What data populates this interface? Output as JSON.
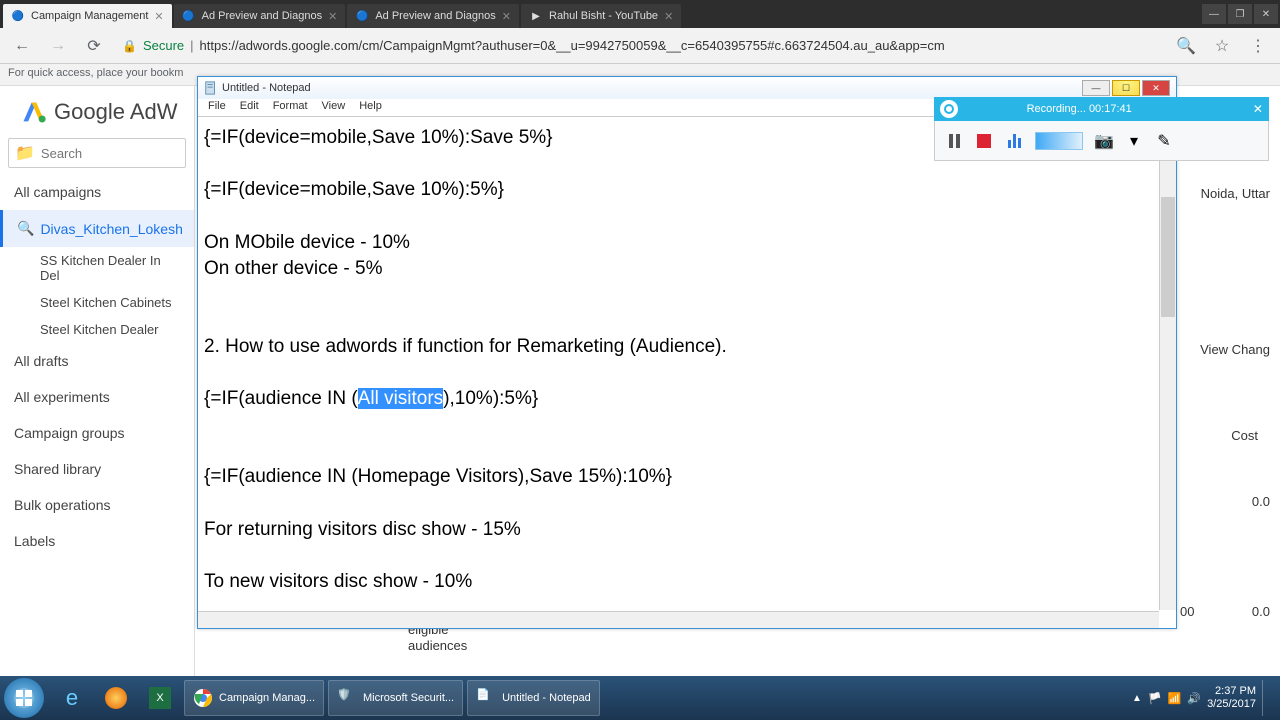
{
  "browser": {
    "tabs": [
      {
        "title": "Campaign Management",
        "fav": "g"
      },
      {
        "title": "Ad Preview and Diagnos",
        "fav": "g"
      },
      {
        "title": "Ad Preview and Diagnos",
        "fav": "g"
      },
      {
        "title": "Rahul Bisht - YouTube",
        "fav": "yt"
      }
    ],
    "secure_label": "Secure",
    "url": "https://adwords.google.com/cm/CampaignMgmt?authuser=0&__u=9942750059&__c=6540395755#c.663724504.au_au&app=cm",
    "bookmark_hint": "For quick access, place your bookm"
  },
  "adwords": {
    "logo": "Google AdW",
    "search_placeholder": "Search",
    "nav": {
      "all_campaigns": "All campaigns",
      "divas": "Divas_Kitchen_Lokesh",
      "subs": [
        "SS Kitchen Dealer In Del",
        "Steel Kitchen Cabinets",
        "Steel Kitchen Dealer"
      ],
      "all_drafts": "All drafts",
      "all_experiments": "All experiments",
      "campaign_groups": "Campaign groups",
      "shared_library": "Shared library",
      "bulk_operations": "Bulk operations",
      "labels": "Labels"
    },
    "right": {
      "location": "Noida, Uttar",
      "view_change": "View Chang",
      "cost": "Cost",
      "v1": "0.0",
      "v2": "00",
      "v3": "0.0",
      "eligible": "eligible",
      "audiences": "audiences"
    }
  },
  "notepad": {
    "title": "Untitled - Notepad",
    "menu": [
      "File",
      "Edit",
      "Format",
      "View",
      "Help"
    ],
    "l1": "{=IF(device=mobile,Save 10%):Save 5%}",
    "l2": "{=IF(device=mobile,Save 10%):5%}",
    "l3": "On MObile device - 10%",
    "l4": "On other device - 5%",
    "l5": "2. How to use adwords if function for Remarketing (Audience).",
    "l6a": "{=IF(audience IN (",
    "l6sel": "All visitors",
    "l6b": "),10%):5%}",
    "l7": "{=IF(audience IN (Homepage Visitors),Save 15%):10%}",
    "l8": "For returning visitors disc show - 15%",
    "l9": "To new visitors disc show - 10%"
  },
  "recorder": {
    "title": "Recording... 00:17:41"
  },
  "taskbar": {
    "apps": [
      "Campaign Manag...",
      "Microsoft Securit...",
      "Untitled - Notepad"
    ],
    "time": "2:37 PM",
    "date": "3/25/2017"
  }
}
